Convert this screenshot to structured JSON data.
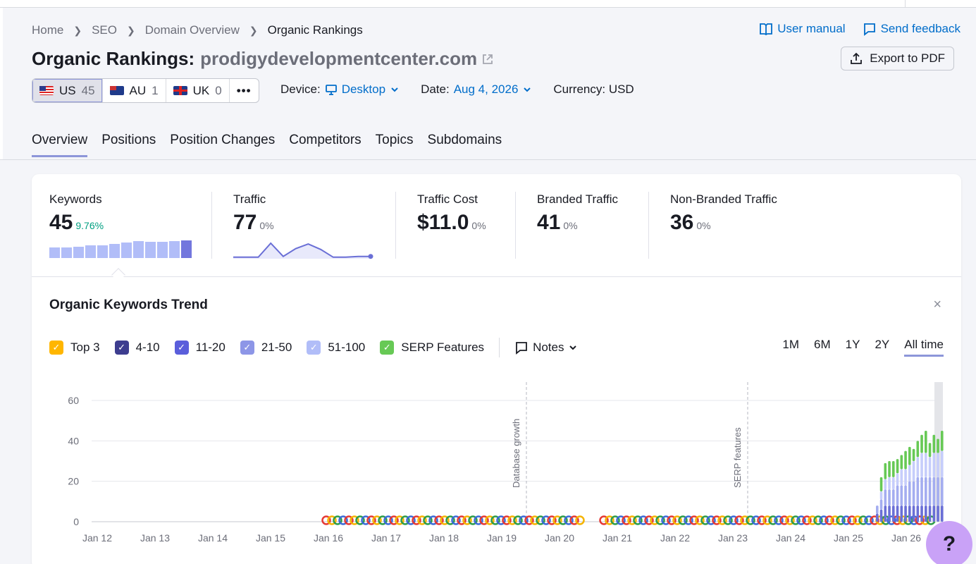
{
  "breadcrumb": [
    "Home",
    "SEO",
    "Domain Overview",
    "Organic Rankings"
  ],
  "title": {
    "prefix": "Organic Rankings:",
    "domain": "prodigydevelopmentcenter.com"
  },
  "links": {
    "manual": "User manual",
    "feedback": "Send feedback",
    "export": "Export to PDF"
  },
  "databases": [
    {
      "code": "US",
      "count": "45",
      "flag": "us-flag"
    },
    {
      "code": "AU",
      "count": "1",
      "flag": "au-flag"
    },
    {
      "code": "UK",
      "count": "0",
      "flag": "uk-flag"
    }
  ],
  "more": "•••",
  "filters": {
    "device_label": "Device:",
    "device_value": "Desktop",
    "date_label": "Date:",
    "date_value": "Aug 4, 2026",
    "currency": "Currency: USD"
  },
  "tabs": [
    "Overview",
    "Positions",
    "Position Changes",
    "Competitors",
    "Topics",
    "Subdomains"
  ],
  "metrics": [
    {
      "label": "Keywords",
      "value": "45",
      "change": "9.76%",
      "trend": [
        14,
        14,
        15,
        17,
        17,
        18,
        20,
        22,
        21,
        21,
        22,
        23
      ]
    },
    {
      "label": "Traffic",
      "value": "77",
      "change": "0%",
      "trend": [
        2,
        2,
        2,
        20,
        3,
        13,
        19,
        12,
        2,
        2,
        3,
        3
      ]
    },
    {
      "label": "Traffic Cost",
      "value": "$11.0",
      "change": "0%"
    },
    {
      "label": "Branded Traffic",
      "value": "41",
      "change": "0%"
    },
    {
      "label": "Non-Branded Traffic",
      "value": "36",
      "change": "0%"
    }
  ],
  "trend_title": "Organic Keywords Trend",
  "close": "×",
  "legend": [
    {
      "label": "Top 3",
      "color": "#ffb600"
    },
    {
      "label": "4-10",
      "color": "#3d3d8f"
    },
    {
      "label": "11-20",
      "color": "#5a5edb"
    },
    {
      "label": "21-50",
      "color": "#8d96e7"
    },
    {
      "label": "51-100",
      "color": "#b1bdf8"
    },
    {
      "label": "SERP Features",
      "color": "#67c955"
    }
  ],
  "notes": "Notes",
  "ranges": [
    "1M",
    "6M",
    "1Y",
    "2Y",
    "All time"
  ],
  "help": "?",
  "chart_data": {
    "type": "bar",
    "ylim": [
      0,
      65
    ],
    "yticks": [
      0,
      20,
      40,
      60
    ],
    "xticks": [
      "Jan 12",
      "Jan 13",
      "Jan 14",
      "Jan 15",
      "Jan 16",
      "Jan 17",
      "Jan 18",
      "Jan 19",
      "Jan 20",
      "Jan 21",
      "Jan 22",
      "Jan 23",
      "Jan 24",
      "Jan 25",
      "Jan 26"
    ],
    "annotations": [
      "Database growth",
      "SERP features"
    ],
    "categories": [
      "Jan 25 (1)",
      "Jan 25 (2)",
      "Jan 25 (3)",
      "Jan 25 (4)",
      "Jan 25 (5)",
      "Jan 25 (6)",
      "Jan 25 (7)",
      "Jan 25 (8)",
      "Jan 25 (9)",
      "Jan 25 (10)",
      "Jan 26 (1)",
      "Jan 26 (2)",
      "Jan 26 (3)",
      "Jan 26 (4)",
      "Jan 26 (5)",
      "Jan 26 (6)",
      "Jan 26 (7)"
    ],
    "series": [
      {
        "name": "4-10",
        "values": [
          0,
          0,
          0,
          0,
          0,
          0,
          0,
          0,
          0,
          0,
          0,
          0,
          0,
          0,
          0,
          0,
          0
        ]
      },
      {
        "name": "11-20",
        "values": [
          4,
          6,
          8,
          8,
          8,
          8,
          8,
          8,
          8,
          8,
          8,
          8,
          8,
          8,
          8,
          8,
          8
        ]
      },
      {
        "name": "21-50",
        "values": [
          4,
          5,
          8,
          8,
          8,
          10,
          10,
          10,
          12,
          12,
          14,
          14,
          14,
          14,
          14,
          14,
          14
        ]
      },
      {
        "name": "51-100",
        "values": [
          0,
          4,
          5,
          6,
          6,
          6,
          8,
          8,
          8,
          10,
          10,
          12,
          12,
          10,
          12,
          12,
          13
        ]
      },
      {
        "name": "SERP Features",
        "values": [
          0,
          7,
          8,
          8,
          8,
          7,
          7,
          9,
          9,
          6,
          8,
          9,
          11,
          7,
          9,
          7,
          10
        ]
      }
    ]
  }
}
